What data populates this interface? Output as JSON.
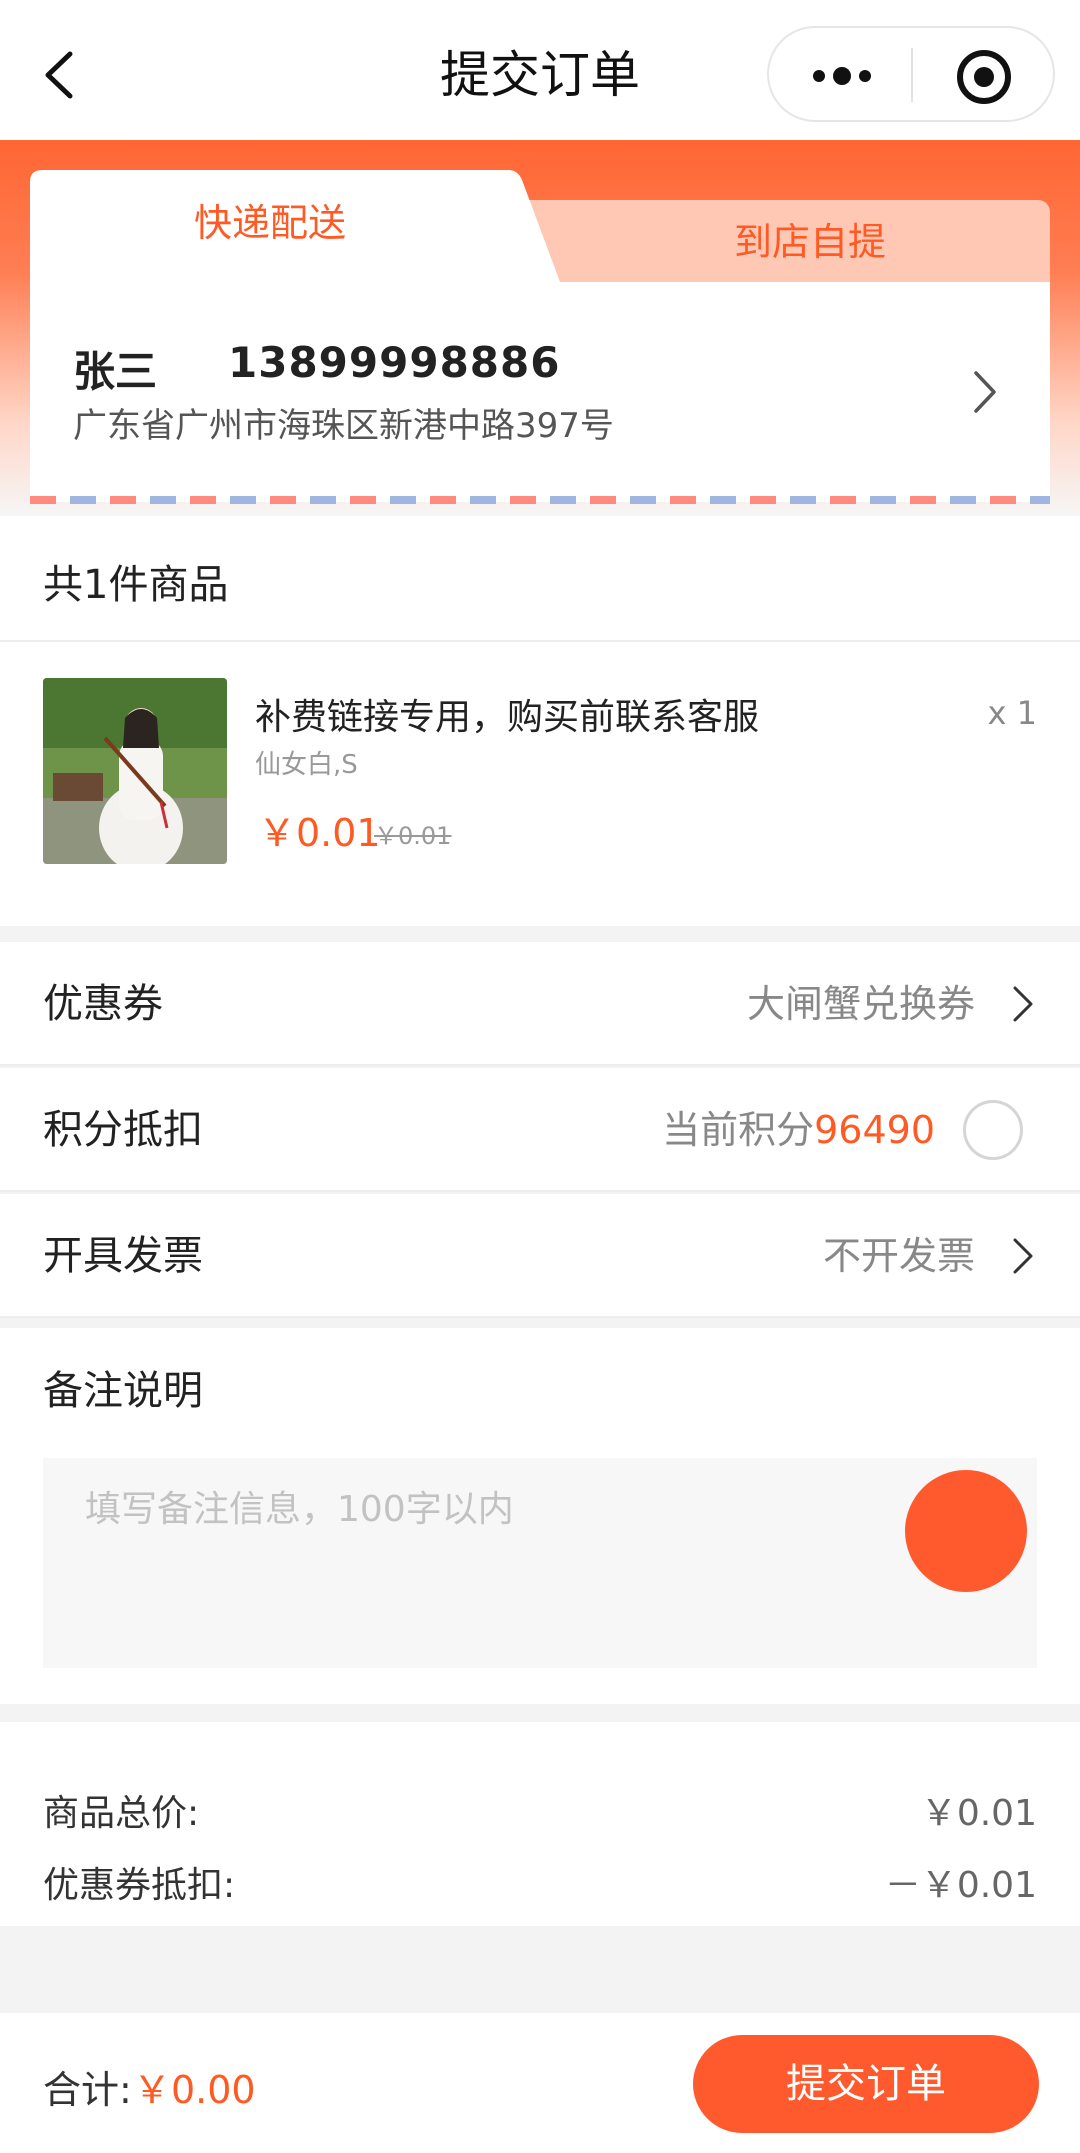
{
  "header": {
    "title": "提交订单",
    "back_icon": "chevron-left-icon",
    "more_icon": "more-dots-icon",
    "close_icon": "target-icon"
  },
  "delivery": {
    "tabs": [
      {
        "label": "快递配送",
        "active": true
      },
      {
        "label": "到店自提",
        "active": false
      }
    ],
    "address": {
      "name": "张三",
      "phone": "13899998886",
      "detail": "广东省广州市海珠区新港中路397号"
    }
  },
  "goods": {
    "count_label": "共1件商品",
    "items": [
      {
        "name": "补费链接专用，购买前联系客服",
        "spec": "仙女白,S",
        "price": "￥0.01",
        "original_price": "￥0.01",
        "quantity": "x 1"
      }
    ]
  },
  "options": {
    "coupon": {
      "label": "优惠券",
      "value": "大闸蟹兑换券"
    },
    "points": {
      "label": "积分抵扣",
      "prefix": "当前积分",
      "value": "96490",
      "checked": false
    },
    "invoice": {
      "label": "开具发票",
      "value": "不开发票"
    }
  },
  "remark": {
    "title": "备注说明",
    "placeholder": "填写备注信息，100字以内"
  },
  "totals": {
    "goods_total": {
      "label": "商品总价:",
      "value": "￥0.01"
    },
    "coupon_deduct": {
      "label": "优惠券抵扣:",
      "value": "－￥0.01"
    }
  },
  "footer": {
    "sum_label": "合计:",
    "sum_value": "￥0.00",
    "submit_label": "提交订单"
  },
  "colors": {
    "accent": "#ff5a2e",
    "accent_light": "#ffc8b5"
  }
}
